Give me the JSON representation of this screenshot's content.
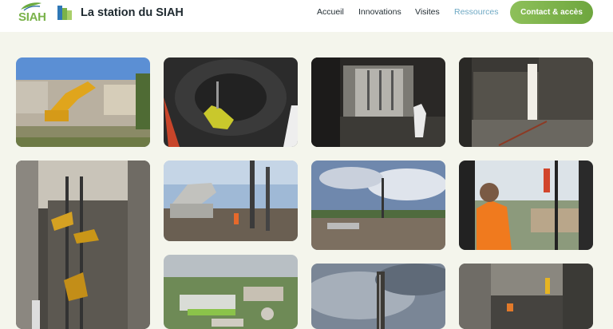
{
  "header": {
    "brand_logo_text": "SIAH",
    "site_title": "La station du SIAH",
    "nav": [
      {
        "label": "Accueil",
        "active": false
      },
      {
        "label": "Innovations",
        "active": false
      },
      {
        "label": "Visites",
        "active": false
      },
      {
        "label": "Ressources",
        "active": true
      }
    ],
    "cta_label": "Contact & accès"
  },
  "colors": {
    "page_background": "#f4f5ec",
    "brand_green": "#7ab24a",
    "active_nav": "#6fa9c4",
    "cta_green": "#7cb24a"
  }
}
